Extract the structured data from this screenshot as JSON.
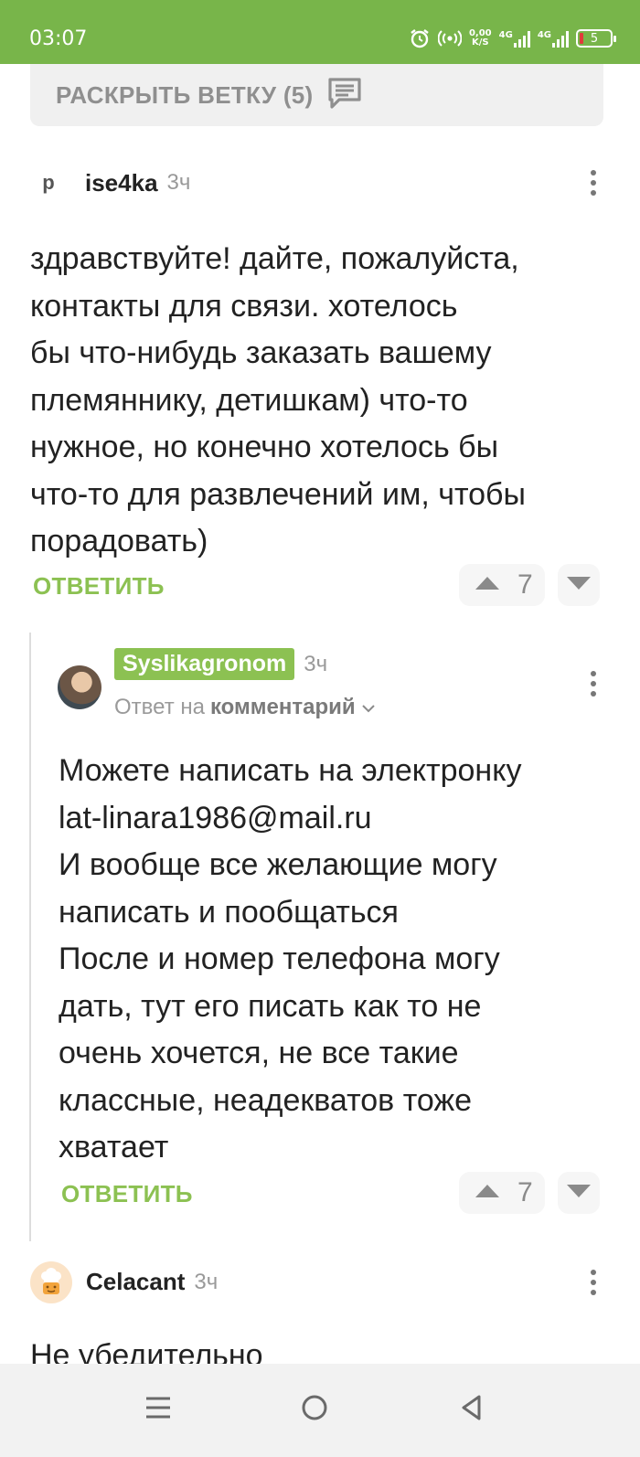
{
  "status_bar": {
    "time": "03:07",
    "net_speed_value": "0,00",
    "net_speed_unit": "K/S",
    "signal1_label": "4G",
    "signal2_label": "4G",
    "battery_level": "5",
    "icons": [
      "alarm-icon",
      "hotspot-icon",
      "signal-icon",
      "signal-icon",
      "battery-icon"
    ]
  },
  "expand_thread": {
    "label": "РАСКРЫТЬ ВЕТКУ (5)",
    "icon": "comments-icon"
  },
  "comments": [
    {
      "avatar_letter": "p",
      "username": "ise4ka",
      "time": "3ч",
      "lines": [
        "здравствуйте! дайте, пожалуйста,",
        "контакты для связи. хотелось",
        "бы что-нибудь заказать вашему",
        "племяннику, детишкам) что-то",
        "нужное, но конечно хотелось бы",
        "что-то для развлечений им, чтобы",
        "порадовать)"
      ],
      "reply_label": "ОТВЕТИТЬ",
      "votes": "7"
    },
    {
      "username": "Syslikagronom",
      "time": "3ч",
      "reply_to_prefix": "Ответ на",
      "reply_to_target": "комментарий",
      "lines": [
        "Можете написать на электронку",
        "lat-linara1986@mail.ru",
        "И вообще все желающие могу",
        "написать и пообщаться",
        "После и номер телефона могу",
        "дать, тут его писать как то не",
        "очень хочется, не все такие",
        "классные, неадекватов тоже",
        "хватает"
      ],
      "reply_label": "ОТВЕТИТЬ",
      "votes": "7"
    },
    {
      "username": "Celacant",
      "time": "3ч",
      "lines": [
        "Не убедительно"
      ]
    }
  ],
  "colors": {
    "status_bar": "#78b54a",
    "accent_green": "#8cc152",
    "muted_text": "#999999"
  },
  "nav_bar": {
    "icons": [
      "menu-icon",
      "home-icon",
      "back-icon"
    ]
  }
}
